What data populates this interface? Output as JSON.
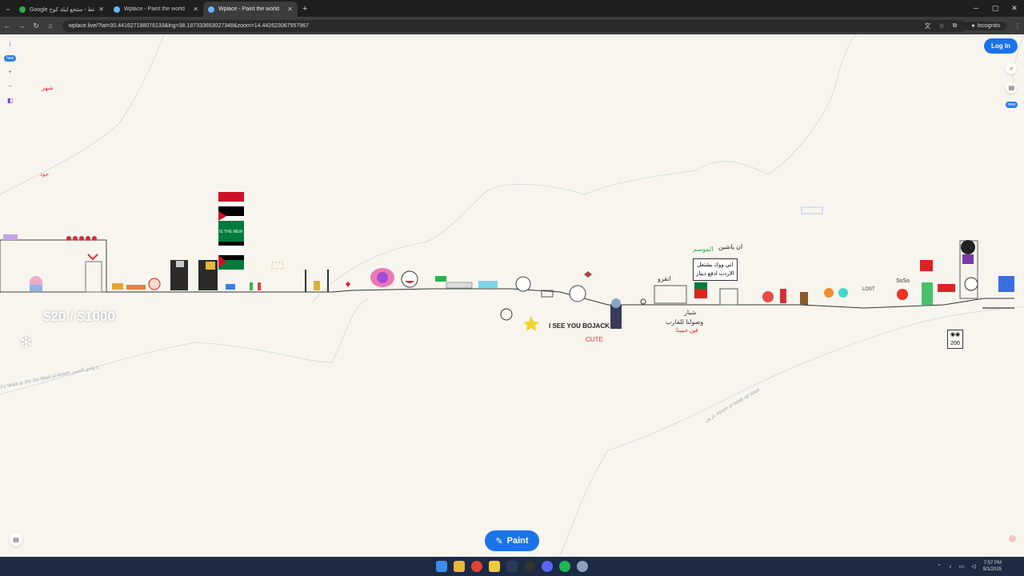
{
  "browser": {
    "tabs": [
      {
        "title": "Google خرائط - منتجع ليلة كوح",
        "active": false
      },
      {
        "title": "Wplace - Paint the world",
        "active": false
      },
      {
        "title": "Wplace - Paint the world",
        "active": true
      }
    ],
    "url": "wplace.live/?lat=30.441627188076133&lng=38.187333653027348&zoom=14.442623067557967",
    "incognito_label": "Incognito"
  },
  "map": {
    "login_label": "Log In",
    "price_label": "$20 / $1000",
    "paint_label": "Paint",
    "new_badge_left": "new",
    "new_badge_right": "new",
    "map_labels": {
      "road_left": "Fo Wadi al Jisr Oo Wadi al Ajrash ح وادي الجسر",
      "road_right": "عرش Ajrash al Wadi ral Wadi"
    },
    "pixel_texts": [
      "شهر",
      "جود",
      "IS THE NEW",
      "اني ووك يشتغل",
      "الاردت ادفع دينار",
      "انقرو",
      "ان ياشين",
      "الموسم",
      "شيار",
      "وصولنا للقارب",
      "فين حبيبنا",
      "I SEE YOU BOJACK",
      "CUTE",
      "SoSo",
      "LOST"
    ],
    "counter_value": "200"
  },
  "taskbar": {
    "time": "7:57 PM",
    "date": "9/1/2025"
  },
  "colors": {
    "map_bg": "#f8f5ef",
    "brand_blue": "#1a73e8",
    "chrome_dark": "#1f1f1f",
    "taskbar": "#1c2a44"
  }
}
